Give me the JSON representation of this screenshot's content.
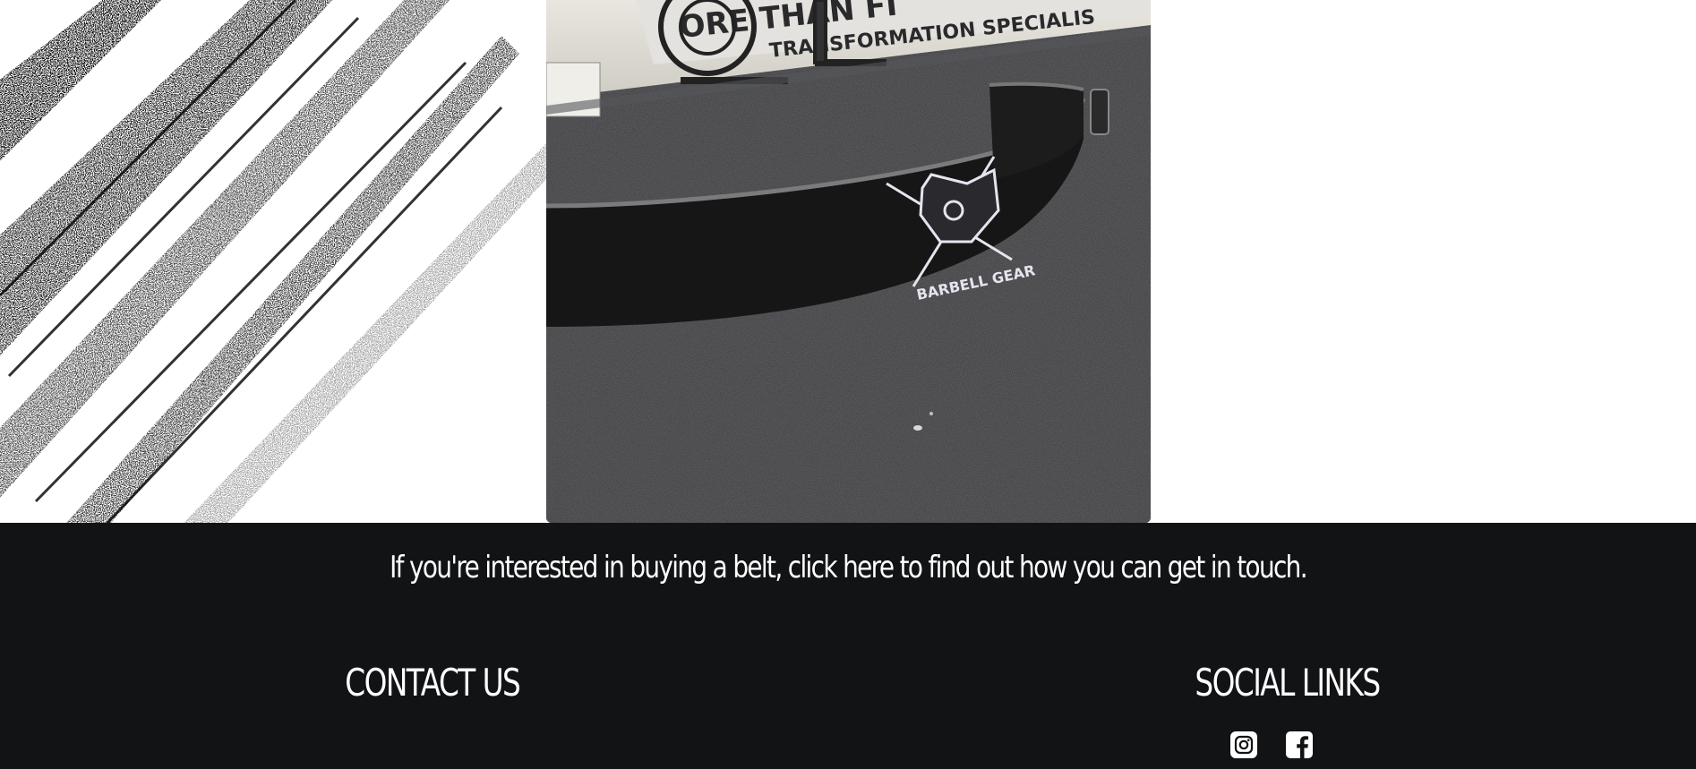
{
  "hero": {
    "photo_icon": "barbell-gear-lifting-belt-photo",
    "texture_icon": "grunge-brush-texture"
  },
  "footer": {
    "cta_text": "If you're interested in buying a belt, click here to find out how you can get in touch.",
    "contact_heading": "CONTACT US",
    "social_heading": "SOCIAL LINKS",
    "social_icons": [
      "instagram-icon",
      "facebook-icon"
    ]
  },
  "colors": {
    "footer_background": "#121315",
    "text": "#ffffff",
    "page_background": "#ffffff"
  }
}
